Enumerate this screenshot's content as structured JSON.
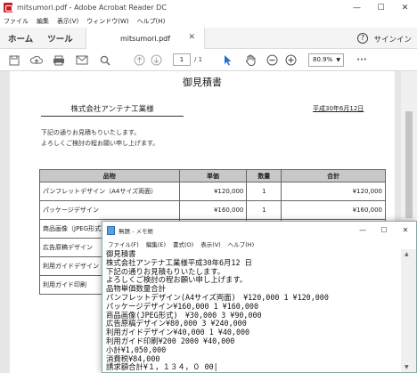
{
  "window": {
    "title": "mitsumori.pdf - Adobe Acrobat Reader DC"
  },
  "menu": [
    "ファイル",
    "編集",
    "表示(V)",
    "ウィンドウ(W)",
    "ヘルプ(H)"
  ],
  "tabs": {
    "home": "ホーム",
    "tools": "ツール",
    "doc": "mitsumori.pdf",
    "signin": "サインイン"
  },
  "toolbar": {
    "page_current": "1",
    "page_total": "/ 1",
    "zoom": "80.9%"
  },
  "pdf": {
    "title": "御見積書",
    "company": "株式会社アンテナ工業様",
    "date": "平成30年6月12日",
    "greet1": "下記の通りお見積もりいたします。",
    "greet2": "よろしくご検討の程お願い申し上げます。",
    "headers": [
      "品物",
      "単価",
      "数量",
      "合計"
    ],
    "rows": [
      [
        "パンフレットデザイン（A4サイズ両面）",
        "¥120,000",
        "1",
        "¥120,000"
      ],
      [
        "パッケージデザイン",
        "¥160,000",
        "1",
        "¥160,000"
      ],
      [
        "商品画像（JPEG形式）",
        "",
        "",
        ""
      ],
      [
        "広告原稿デザイン",
        "",
        "",
        ""
      ],
      [
        "利用ガイドデザイン",
        "",
        "",
        ""
      ],
      [
        "利用ガイド印刷",
        "",
        "",
        ""
      ]
    ]
  },
  "notepad": {
    "title": "無題 - メモ帳",
    "menu": [
      "ファイル(F)",
      "編集(E)",
      "書式(O)",
      "表示(V)",
      "ヘルプ(H)"
    ],
    "text": "御見積書\n株式会社アンテナ工業様平成30年6月12 日\n下記の通りお見積もりいたします。\nよろしくご検討の程お願い申し上げます。\n品物単価数量合計\nパンフレットデザイン(A4サイズ両面)　¥120,000 1 ¥120,000\nパッケージデザイン¥160,000 1 ¥160,000\n商品画像(JPEG形式)　¥30,000 3 ¥90,000\n広告原稿デザイン¥80,000 3 ¥240,000\n利用ガイドデザイン¥40,000 1 ¥40,000\n利用ガイド印刷¥200 2000 ¥40,000\n小計¥1,050,000\n消費税¥84,000\n請求額合計¥１，１３４，０ 00|"
  }
}
